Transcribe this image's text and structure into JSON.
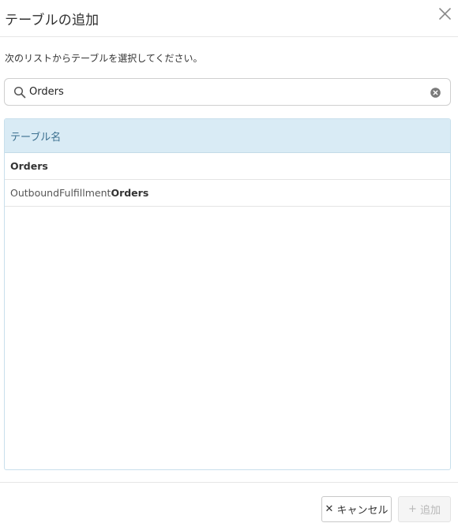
{
  "dialog": {
    "title": "テーブルの追加",
    "instruction": "次のリストからテーブルを選択してください。"
  },
  "search": {
    "value": "Orders",
    "placeholder": ""
  },
  "table": {
    "header": "テーブル名",
    "rows": [
      {
        "prefix": "",
        "match": "Orders"
      },
      {
        "prefix": "OutboundFulfillment",
        "match": "Orders"
      }
    ]
  },
  "footer": {
    "cancel_label": "キャンセル",
    "add_label": "追加",
    "add_disabled": true
  },
  "icons": {
    "close": "close-icon",
    "search": "search-icon",
    "clear": "clear-icon",
    "cancel": "x-icon",
    "add": "plus-icon"
  }
}
